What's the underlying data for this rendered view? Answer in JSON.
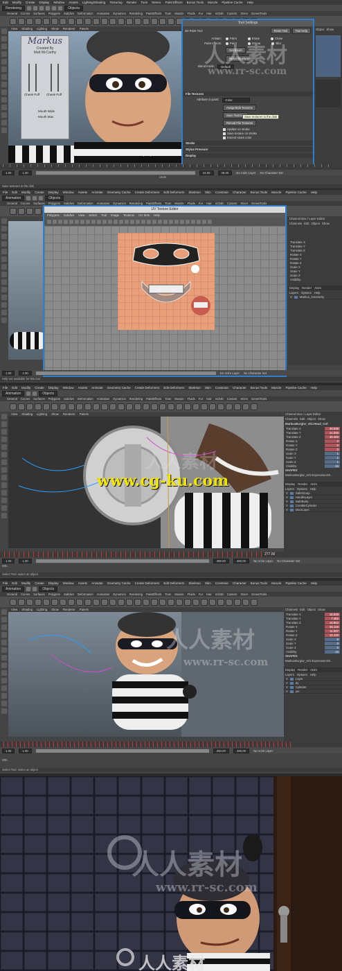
{
  "panels": {
    "menu": [
      "Edit",
      "Modify",
      "Create",
      "Display",
      "Window",
      "Assets",
      "Lighting/Shading",
      "Texturing",
      "Render",
      "Toon",
      "Stereo",
      "Paint Effects",
      "Bonus Tools",
      "Muscle",
      "Pipeline Cache",
      "Help"
    ],
    "menu2": [
      "File",
      "Edit",
      "Modify",
      "Create",
      "Display",
      "Window",
      "Assets",
      "Animate",
      "Geometry Cache",
      "Create Deformers",
      "Edit Deformers",
      "Skeleton",
      "Skin",
      "Constrain",
      "Character",
      "Bonus Tools",
      "Muscle",
      "Pipeline Cache",
      "Help"
    ],
    "menu3": [
      "File",
      "Edit",
      "Modify",
      "Create",
      "Display",
      "Window",
      "Assets",
      "Animate",
      "Geometry Cache",
      "Create Deformers",
      "Edit Deformers",
      "Skeleton",
      "Skin",
      "Constrain",
      "Character",
      "Bonus Tools",
      "Muscle",
      "Pipeline Cache",
      "Help"
    ],
    "menu4": [
      "File",
      "Edit",
      "Modify",
      "Create",
      "Display",
      "Window",
      "Assets",
      "Animate",
      "Geometry Cache",
      "Create Deformers",
      "Edit Deformers",
      "Skeleton",
      "Skin",
      "Constrain",
      "Character",
      "Bonus Tools",
      "Muscle",
      "Pipeline Cache",
      "Help"
    ],
    "mode_rendering": "Rendering",
    "mode_animation": "Animation",
    "objects": "Objects",
    "shelf_tabs": [
      "General",
      "Curves",
      "Surfaces",
      "Polygons",
      "Subdivs",
      "Deformation",
      "Animation",
      "Dynamics",
      "Rendering",
      "PaintEffects",
      "Toon",
      "Muscle",
      "Fluids",
      "Fur",
      "Hair",
      "nCloth",
      "Custom",
      "XGen",
      "GenesTools"
    ],
    "viewport_menu": [
      "View",
      "Shading",
      "Lighting",
      "Show",
      "Renderer",
      "Panels"
    ]
  },
  "tool_settings": {
    "title": "Tool Settings",
    "tool_name": "3D Paint Tool",
    "reset_tool": "Reset Tool",
    "tool_help": "Tool Help",
    "artisan_label": "Artisan:",
    "artisan_opts": [
      "Paint",
      "Erase",
      "Clone"
    ],
    "paint_effects_label": "Paint effects:",
    "paint_effects_opts": [
      "Paint",
      "Smear",
      "Blur"
    ],
    "get_brush": "Get Brush",
    "reset_brushes": "Reset Brushes",
    "blend_mode_label": "Blend mode:",
    "blend_mode_value": "Default",
    "file_textures": "File Textures",
    "attribute_label": "Attribute to paint:",
    "attribute_value": "Color",
    "assign_edit": "Assign/Edit Textures",
    "save_textures": "Save Textures",
    "reload_textures": "Reload File Textures",
    "tooltip": "Save textures to the disk",
    "update_on_stroke": "Update on stroke",
    "save_on_stroke": "Save texture on stroke",
    "extend_seam": "Extend seam color",
    "stroke": "Stroke",
    "stylus_pressure": "Stylus Pressure",
    "display": "Display",
    "help_line": "Save textures to the disk"
  },
  "uv_editor": {
    "title": "UV Texture Editor",
    "menu": [
      "Polygons",
      "Subdivs",
      "View",
      "Select",
      "Tool",
      "Image",
      "Textures",
      "UV Sets",
      "Help"
    ],
    "help_line": "Help not available for this tool"
  },
  "channel_box": {
    "tabs": [
      "Channel Box / Layer Editor"
    ],
    "menu": [
      "Channels",
      "Edit",
      "Object",
      "Show"
    ],
    "rows": [
      "Translate X",
      "Translate Y",
      "Translate Z",
      "Rotate X",
      "Rotate Y",
      "Rotate Z",
      "Scale X",
      "Scale Y",
      "Scale Z",
      "Visibility"
    ],
    "object_name": "MarkusBurglar_v01:Head_Ctrl",
    "shapes": "SHAPES",
    "shape_name": "MarkusBurglar_v01:ExpressionSh...",
    "display_tabs": [
      "Display",
      "Render",
      "Anim"
    ],
    "layers_menu": [
      "Layers",
      "Options",
      "Help"
    ],
    "layers_panel2": [
      "Markus_Geometry"
    ],
    "layers_panel3": [
      "SafeGroup",
      "HandleLayer",
      "SafeBody",
      "CombleCylinder",
      "DoorLayer"
    ],
    "layers_panel4": [
      "Layer",
      "dy",
      "Cylinder",
      "yer"
    ],
    "values3": [
      "48.936",
      "21.000",
      "48.400",
      "0",
      "0",
      "0",
      "1",
      "1",
      "1",
      "on"
    ],
    "values4": [
      "15.829",
      "7.382",
      "15.863",
      "39.100",
      "11.007",
      "10.100",
      "0",
      "0",
      "0",
      "on"
    ]
  },
  "timeline": {
    "p1_range": [
      "1.00",
      "1.00",
      "24.00",
      "48.00"
    ],
    "p1_layer": "No Anim Layer",
    "p1_char": "No Character Set",
    "p1_cmd": "Undo",
    "p1_help": "Save textures to the disk",
    "p3_range": [
      "1.00",
      "1.00",
      "480.00",
      "480.00"
    ],
    "p3_frame": "277.00",
    "p3_help": "Select Tool: select an object",
    "p4_range": [
      "1.00",
      "1.00",
      "260.00",
      "480.00"
    ],
    "p4_help": "Select Tool: select an object",
    "mel": "MEL"
  },
  "artwork": {
    "poster_title": "Markus",
    "poster_created": "Created By",
    "poster_author": "Matt McCarthy",
    "poster_labels": [
      "Cheek Puff",
      "Cheek Puff",
      "Mouth Wide",
      "Mouth Max"
    ],
    "persp": "persp"
  },
  "watermarks": {
    "site1": "www.rr-sc.com",
    "site2": "www.cg-ku.com",
    "brand": "人人素材"
  },
  "colors": {
    "dialog_border": "#2f7fd0",
    "watermark_yellow": "#f2e600",
    "uv_skin": "#e9a07a"
  }
}
